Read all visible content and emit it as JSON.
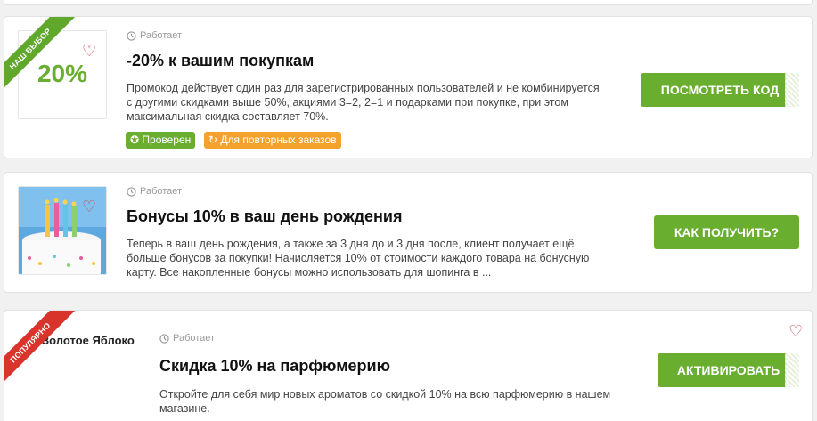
{
  "cards": [
    {
      "ribbon": "НАШ ВЫБОР",
      "discount": "20%",
      "status": "Работает",
      "title": "-20% к вашим покупкам",
      "description": "Промокод действует один раз для зарегистрированных пользователей и не комбинируется с другими скидками выше 50%, акциями 3=2, 2=1 и подарками при покупке, при этом максимальная скидка составляет 70%.",
      "badges": [
        "Проверен",
        "Для повторных заказов"
      ],
      "button": "ПОСМОТРЕТЬ КОД"
    },
    {
      "status": "Работает",
      "title": "Бонусы 10% в ваш день рождения",
      "description": "Теперь в ваш день рождения, а также за 3 дня до и 3 дня после, клиент получает ещё больше бонусов за покупки! Начисляется 10% от стоимости каждого товара на бонусную карту. Все накопленные бонусы можно использовать для шопинга в ...",
      "button": "КАК ПОЛУЧИТЬ?"
    },
    {
      "ribbon": "ПОПУЛЯРНО",
      "brand": "Золотое Яблоко",
      "status": "Работает",
      "title": "Скидка 10% на парфюмерию",
      "description": "Откройте для себя мир новых ароматов со скидкой 10% на всю парфюмерию в нашем магазине.",
      "button": "АКТИВИРОВАТЬ"
    }
  ],
  "colors": {
    "accent_green": "#6aae2f",
    "badge_orange": "#f5a22d",
    "ribbon_red": "#d8342b",
    "heart": "#c9535d"
  },
  "icons": [
    "heart-icon",
    "clock-icon",
    "check-circle-icon",
    "refresh-icon"
  ]
}
